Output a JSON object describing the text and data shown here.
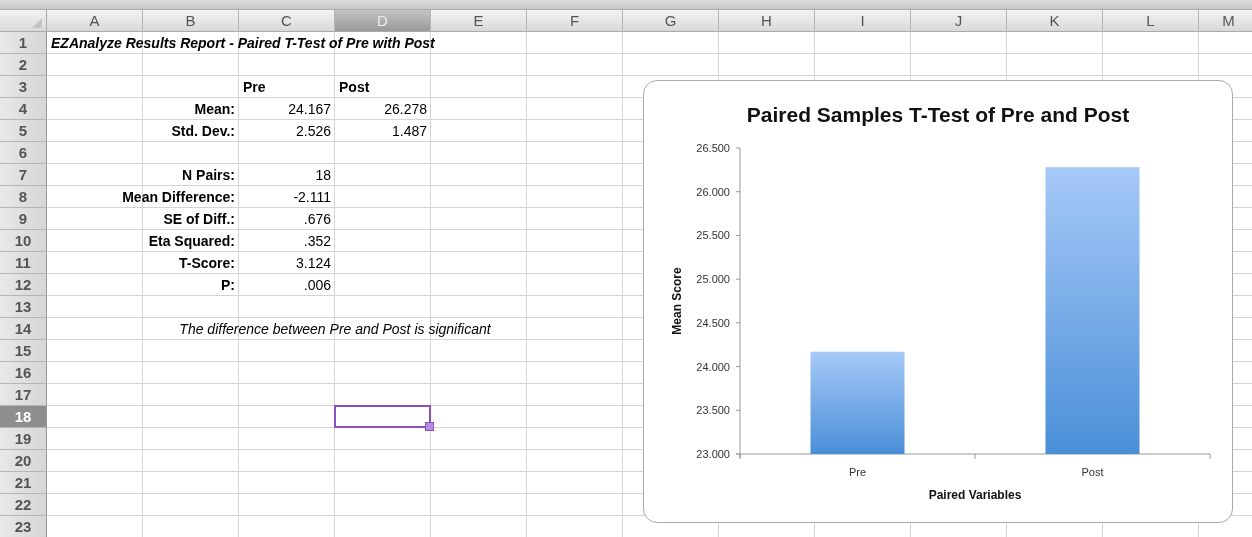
{
  "columns": [
    {
      "label": "A",
      "selected": false
    },
    {
      "label": "B",
      "selected": false
    },
    {
      "label": "C",
      "selected": false
    },
    {
      "label": "D",
      "selected": true
    },
    {
      "label": "E",
      "selected": false
    },
    {
      "label": "F",
      "selected": false
    },
    {
      "label": "G",
      "selected": false
    },
    {
      "label": "H",
      "selected": false
    },
    {
      "label": "I",
      "selected": false
    },
    {
      "label": "J",
      "selected": false
    },
    {
      "label": "K",
      "selected": false
    },
    {
      "label": "L",
      "selected": false
    },
    {
      "label": "M",
      "selected": false
    }
  ],
  "rows": [
    {
      "number": "1",
      "selected": false,
      "cells": {
        "A": {
          "kind": "title",
          "text": "EZAnalyze Results Report - Paired T-Test of Pre with Post"
        }
      }
    },
    {
      "number": "2",
      "selected": false
    },
    {
      "number": "3",
      "selected": false,
      "cells": {
        "C": {
          "kind": "header",
          "text": "Pre"
        },
        "D": {
          "kind": "header",
          "text": "Post"
        }
      }
    },
    {
      "number": "4",
      "selected": false,
      "cells": {
        "B": {
          "kind": "label",
          "text": "Mean:"
        },
        "C": {
          "kind": "value",
          "text": "24.167"
        },
        "D": {
          "kind": "value",
          "text": "26.278"
        }
      }
    },
    {
      "number": "5",
      "selected": false,
      "cells": {
        "B": {
          "kind": "label",
          "text": "Std. Dev.:"
        },
        "C": {
          "kind": "value",
          "text": "2.526"
        },
        "D": {
          "kind": "value",
          "text": "1.487"
        }
      }
    },
    {
      "number": "6",
      "selected": false
    },
    {
      "number": "7",
      "selected": false,
      "cells": {
        "B": {
          "kind": "label",
          "text": "N Pairs:"
        },
        "C": {
          "kind": "value",
          "text": "18"
        }
      }
    },
    {
      "number": "8",
      "selected": false,
      "cells": {
        "B": {
          "kind": "label",
          "text": "Mean Difference:"
        },
        "C": {
          "kind": "value",
          "text": "-2.111"
        }
      }
    },
    {
      "number": "9",
      "selected": false,
      "cells": {
        "B": {
          "kind": "label",
          "text": "SE of Diff.:"
        },
        "C": {
          "kind": "value",
          "text": ".676"
        }
      }
    },
    {
      "number": "10",
      "selected": false,
      "cells": {
        "B": {
          "kind": "label",
          "text": "Eta Squared:"
        },
        "C": {
          "kind": "value",
          "text": ".352"
        }
      }
    },
    {
      "number": "11",
      "selected": false,
      "cells": {
        "B": {
          "kind": "label",
          "text": "T-Score:"
        },
        "C": {
          "kind": "value",
          "text": "3.124"
        }
      }
    },
    {
      "number": "12",
      "selected": false,
      "cells": {
        "B": {
          "kind": "label",
          "text": "P:"
        },
        "C": {
          "kind": "value",
          "text": ".006"
        }
      }
    },
    {
      "number": "13",
      "selected": false
    },
    {
      "number": "14",
      "selected": false,
      "cells": {
        "B": {
          "kind": "note",
          "text": "The difference between Pre and Post is significant"
        }
      }
    },
    {
      "number": "15",
      "selected": false
    },
    {
      "number": "16",
      "selected": false
    },
    {
      "number": "17",
      "selected": false
    },
    {
      "number": "18",
      "selected": true
    },
    {
      "number": "19",
      "selected": false
    },
    {
      "number": "20",
      "selected": false
    },
    {
      "number": "21",
      "selected": false
    },
    {
      "number": "22",
      "selected": false
    },
    {
      "number": "23",
      "selected": false
    }
  ],
  "chart": {
    "chart_data": {
      "type": "bar",
      "title": "Paired Samples T-Test of Pre and Post",
      "xlabel": "Paired Variables",
      "ylabel": "Mean Score",
      "categories": [
        "Pre",
        "Post"
      ],
      "series": [
        {
          "color": "#4a8fd8",
          "values": [
            24.17,
            26.28
          ]
        }
      ],
      "ylim": [
        23,
        26.5
      ],
      "yticks": [
        {
          "value": 23,
          "label": "23.000"
        },
        {
          "value": 23.5,
          "label": "23.500"
        },
        {
          "value": 24,
          "label": "24.000"
        },
        {
          "value": 24.5,
          "label": "24.500"
        },
        {
          "value": 25,
          "label": "25.000"
        },
        {
          "value": 25.5,
          "label": "25.500"
        },
        {
          "value": 26,
          "label": "26.000"
        },
        {
          "value": 26.5,
          "label": "26.500"
        }
      ]
    }
  }
}
